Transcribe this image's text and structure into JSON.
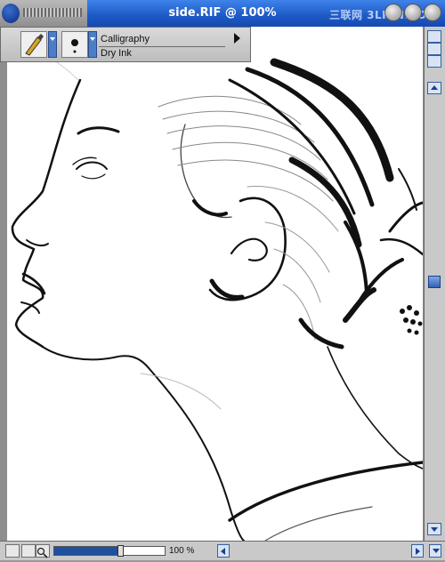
{
  "window": {
    "title": "side.RIF @ 100%",
    "watermark": "三联网 3LIAN.COM",
    "title_bar_color": "#1f5cc8"
  },
  "property_bar": {
    "brush_category_icon": "calligraphy-pen-icon",
    "brush_dab_icon": "brush-dab-icon",
    "brush_name": "Calligraphy",
    "brush_variant": "Dry Ink"
  },
  "canvas": {
    "background": "#ffffff",
    "artwork": "ink sketch portrait"
  },
  "zoom": {
    "label": "100 %",
    "slider_level": 0.6
  },
  "icons": {
    "navigator": "navigator-icon",
    "grid": "grid-icon",
    "zoom": "magnifier-icon",
    "tracing": "tracing-paper-icon"
  }
}
